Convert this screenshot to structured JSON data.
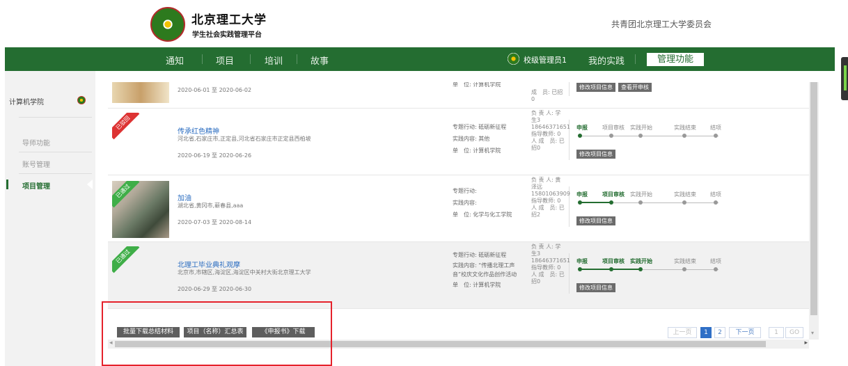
{
  "header": {
    "title": "北京理工大学",
    "subtitle": "学生社会实践管理平台",
    "org": "共青团北京理工大学委员会"
  },
  "nav": {
    "items": [
      "通知",
      "项目",
      "培训",
      "故事"
    ],
    "user": "校级管理员1",
    "my_practice": "我的实践",
    "manage": "管理功能"
  },
  "sidebar": {
    "college": "计算机学院",
    "items": [
      "导师功能",
      "账号管理",
      "项目管理"
    ],
    "active": "项目管理"
  },
  "rows": [
    {
      "status": "",
      "title": "",
      "address": "",
      "date": "2020-06-01 至 2020-06-02",
      "special": "",
      "content": "",
      "unit": "单　位:  计算机学院",
      "person": "成　员: 已招0",
      "buttons": [
        "修改项目信息",
        "查看开申核"
      ]
    },
    {
      "status": "已驳回",
      "title": "传承红色精神",
      "address": "河北省,石家庄市,正定县,河北省石家庄市正定县西柏坡",
      "date": "2020-06-19 至 2020-06-26",
      "special": "专题行动:  砥砺新征程",
      "content": "实践内容:  其他",
      "unit": "单　位:  计算机学院",
      "person": "负 责 人: 学生3 18646371651 指导教师: 0人 成　员: 已招0",
      "buttons": [
        "修改项目信息"
      ]
    },
    {
      "status": "已通过",
      "title": "加油",
      "address": "湖北省,黄冈市,蕲春县,aaa",
      "date": "2020-07-03 至 2020-08-14",
      "special": "专题行动:",
      "content": "实践内容:",
      "unit": "单　位:  化学与化工学院",
      "person": "负 责 人: 黄泽远 15801063909 指导教师: 0人 成　员: 已招2",
      "buttons": [
        "修改项目信息"
      ]
    },
    {
      "status": "已通过",
      "title": "北理工毕业典礼观摩",
      "address": "北京市,市辖区,海淀区,海淀区中关村大街北京理工大学",
      "date": "2020-06-29 至 2020-06-30",
      "special": "专题行动:  砥砺新征程",
      "content": "实践内容:  “传播北理工声音”校庆文化作品创作活动",
      "unit": "单　位:  计算机学院",
      "person": "负 责 人: 学生3 18646371651 指导教师: 0人 成　员: 已招0",
      "buttons": [
        "修改项目信息"
      ]
    }
  ],
  "steps": [
    "申报",
    "项目审核",
    "实践开始",
    "实践结束",
    "结项"
  ],
  "step_progress": [
    1,
    2,
    2,
    3
  ],
  "bottom": {
    "batch_download": "批量下载总结材料",
    "project_summary": "项目（名称）汇总表",
    "declaration_download": "《申报书》下载"
  },
  "pager": {
    "prev": "上一页",
    "pages": [
      "1",
      "2"
    ],
    "current": "1",
    "next": "下一页",
    "input": "1",
    "go": "GO"
  }
}
